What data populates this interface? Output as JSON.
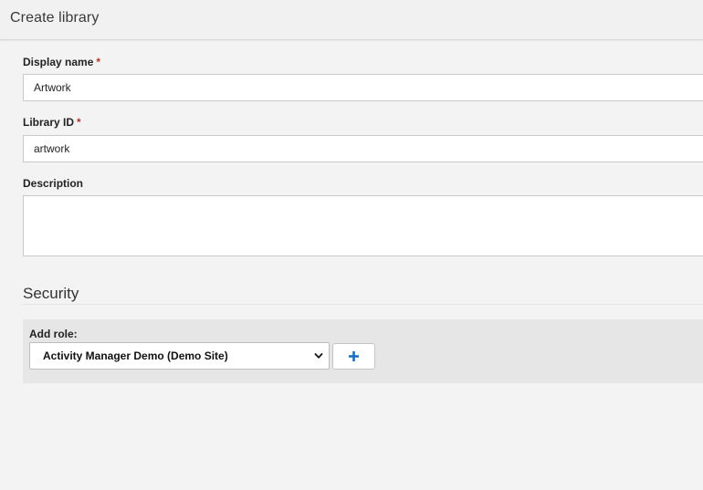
{
  "header": {
    "title": "Create library"
  },
  "form": {
    "display_name": {
      "label": "Display name",
      "required_mark": "*",
      "value": "Artwork"
    },
    "library_id": {
      "label": "Library ID",
      "required_mark": "*",
      "value": "artwork"
    },
    "description": {
      "label": "Description",
      "value": ""
    }
  },
  "security": {
    "title": "Security",
    "add_role": {
      "label": "Add role:",
      "selected": "Activity Manager Demo (Demo Site)",
      "add_button_icon": "plus-icon"
    }
  },
  "colors": {
    "background": "#f3f3f3",
    "required_asterisk": "#b03a2e",
    "plus_accent": "#1f6fc0",
    "role_panel": "#e6e6e6"
  }
}
